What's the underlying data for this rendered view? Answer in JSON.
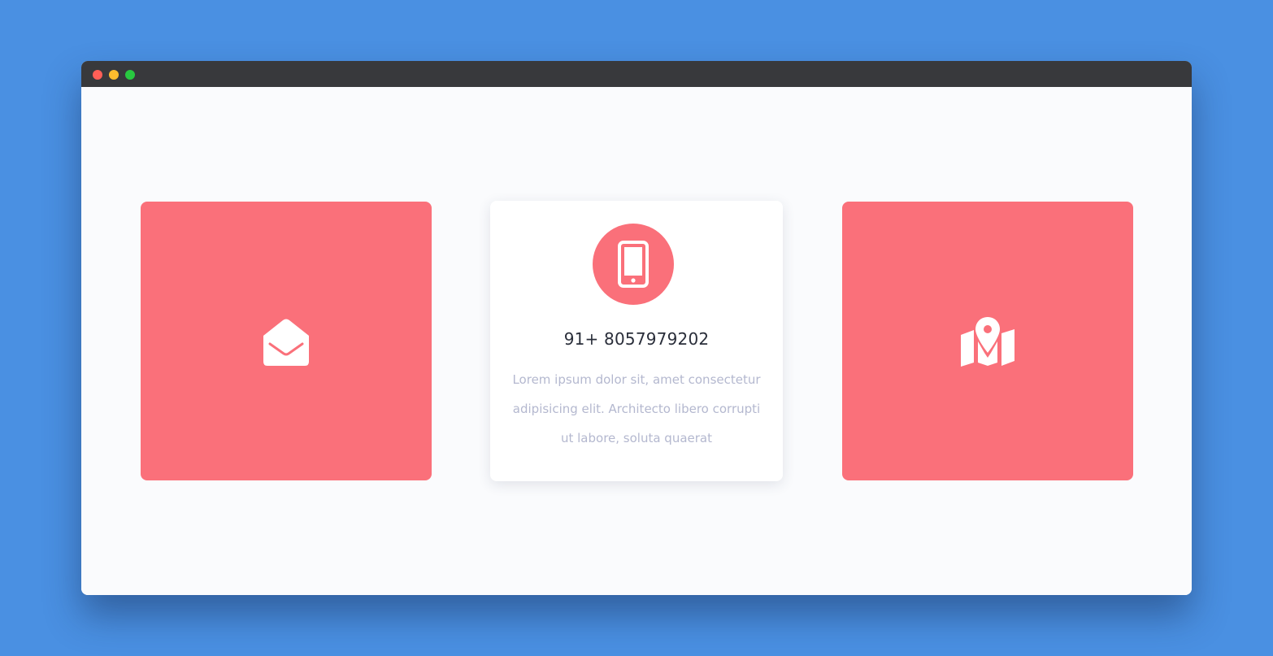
{
  "window": {
    "buttons": [
      {
        "name": "close",
        "color": "#ff5f57"
      },
      {
        "name": "minimize",
        "color": "#ffbd2e"
      },
      {
        "name": "maximize",
        "color": "#28c940"
      }
    ]
  },
  "colors": {
    "accent": "#fa707a",
    "background": "#4a90e2",
    "titlebar": "#38393c",
    "card": "#ffffff",
    "heading": "#2a2e3a",
    "muted": "#b4b8cf"
  },
  "cards": [
    {
      "icon": "envelope-open-icon"
    },
    {
      "icon": "mobile-phone-icon",
      "title": "91+ 8057979202",
      "text": "Lorem ipsum dolor sit, amet consectetur adipisicing elit. Architecto libero corrupti ut labore, soluta quaerat"
    },
    {
      "icon": "map-marker-icon"
    }
  ]
}
